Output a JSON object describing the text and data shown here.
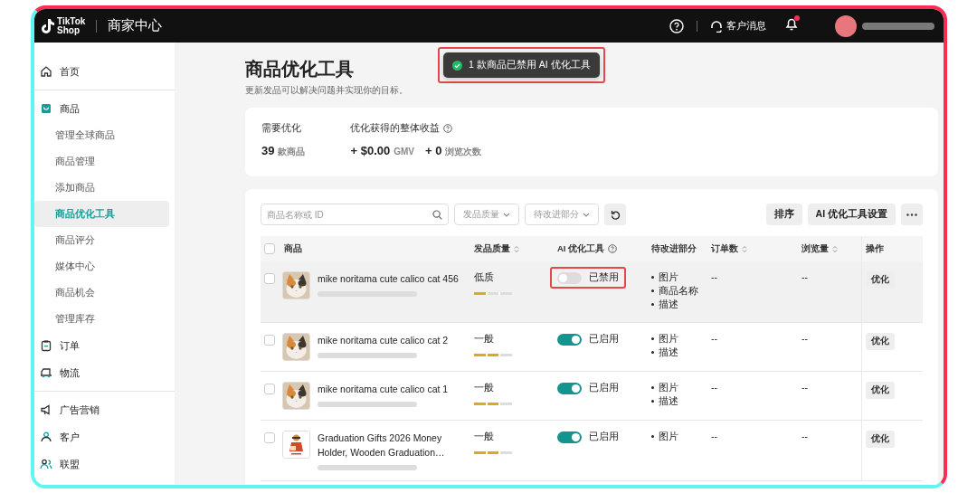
{
  "header": {
    "logo_line1": "TikTok",
    "logo_line2": "Shop",
    "title": "商家中心",
    "messages_label": "客户消息",
    "notification_dot": true
  },
  "sidebar": {
    "groups": [
      {
        "items": [
          {
            "label": "首页",
            "selected": false
          }
        ]
      },
      {
        "items": [
          {
            "label": "商品",
            "selected": false,
            "expanded": true,
            "children": [
              {
                "label": "管理全球商品",
                "selected": false
              },
              {
                "label": "商品管理",
                "selected": false
              },
              {
                "label": "添加商品",
                "selected": false
              },
              {
                "label": "商品优化工具",
                "selected": true
              },
              {
                "label": "商品评分",
                "selected": false
              },
              {
                "label": "媒体中心",
                "selected": false
              },
              {
                "label": "商品机会",
                "selected": false
              },
              {
                "label": "管理库存",
                "selected": false
              }
            ]
          },
          {
            "label": "订单",
            "selected": false
          },
          {
            "label": "物流",
            "selected": false
          }
        ]
      },
      {
        "items": [
          {
            "label": "广告营销",
            "selected": false
          },
          {
            "label": "客户",
            "selected": false
          },
          {
            "label": "联盟",
            "selected": false
          }
        ]
      }
    ]
  },
  "page": {
    "title": "商品优化工具",
    "subtitle": "更新发品可以解决问题并实现你的目标。"
  },
  "toast": {
    "text": "1 款商品已禁用 AI 优化工具",
    "highlighted": true
  },
  "summary": {
    "needs_label": "需要优化",
    "count": "39",
    "count_unit": "款商品",
    "gains_label": "优化获得的整体收益",
    "gmv": "+ $0.00",
    "gmv_unit": "GMV",
    "views": "+ 0",
    "views_unit": "浏览次数"
  },
  "toolbar": {
    "search": {
      "placeholder": "商品名称或 ID"
    },
    "filters": [
      "发品质量",
      "待改进部分"
    ],
    "buttons": [
      "排序",
      "AI 优化工具设置"
    ]
  },
  "table": {
    "select_all": {
      "checked": false
    },
    "columns": [
      {
        "label": "商品",
        "sortable": false,
        "help": false
      },
      {
        "label": "发品质量",
        "sortable": true,
        "help": false
      },
      {
        "label": "AI 优化工具",
        "sortable": false,
        "help": true
      },
      {
        "label": "待改进部分",
        "sortable": false,
        "help": false
      },
      {
        "label": "订单数",
        "sortable": true,
        "help": false
      },
      {
        "label": "浏览量",
        "sortable": true,
        "help": false
      },
      {
        "label": "操作",
        "sortable": false,
        "help": false
      }
    ],
    "rows": [
      {
        "name": "mike noritama cute calico cat 456",
        "image": {
          "kind": "picture"
        },
        "quality": "低质",
        "level": 0.33,
        "ai_on": false,
        "ai_label": "已禁用",
        "highlighted": true,
        "hovered": true,
        "issues": [
          "图片",
          "商品名称",
          "描述"
        ],
        "orders": "--",
        "views": "--",
        "action": "优化",
        "checked": false
      },
      {
        "name": "mike noritama cute calico cat 2",
        "image": {
          "kind": "picture"
        },
        "quality": "一般",
        "level": 0.67,
        "ai_on": true,
        "ai_label": "已启用",
        "highlighted": false,
        "hovered": false,
        "issues": [
          "图片",
          "描述"
        ],
        "orders": "--",
        "views": "--",
        "action": "优化",
        "checked": false
      },
      {
        "name": "mike noritama cute calico cat 1",
        "image": {
          "kind": "picture"
        },
        "quality": "一般",
        "level": 0.67,
        "ai_on": true,
        "ai_label": "已启用",
        "highlighted": false,
        "hovered": false,
        "issues": [
          "图片",
          "描述"
        ],
        "orders": "--",
        "views": "--",
        "action": "优化",
        "checked": false
      },
      {
        "name": "Graduation Gifts 2026 Money Holder, Wooden Graduation…",
        "image": {
          "kind": "picture"
        },
        "quality": "一般",
        "level": 0.67,
        "ai_on": true,
        "ai_label": "已启用",
        "highlighted": false,
        "hovered": false,
        "issues": [
          "图片"
        ],
        "orders": "--",
        "views": "--",
        "action": "优化",
        "checked": false
      }
    ]
  }
}
